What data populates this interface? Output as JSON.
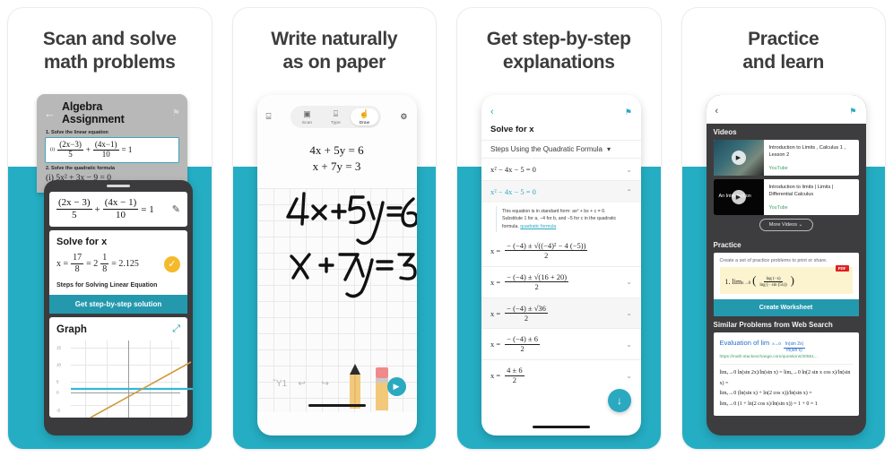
{
  "accent": {
    "teal": "#25adc3",
    "teal_dark": "#2499ae",
    "yellow": "#f5ba2b",
    "link_blue": "#2a6fc9",
    "green": "#3f9c6d",
    "pdf_red": "#e02020"
  },
  "panels": [
    {
      "id": "panel-scan",
      "headline_line1": "Scan and solve",
      "headline_line2": "math problems",
      "worksheet": {
        "back_icon": "←",
        "title": "Algebra Assignment",
        "flag_icon": "⚑",
        "q1_label": "1. Solve the linear equation",
        "q1_marker": "(i)",
        "q1_num_a": "(2x−3)",
        "q1_den_a": "5",
        "q1_plus": "+",
        "q1_num_b": "(4x−1)",
        "q1_den_b": "10",
        "q1_equals": "= 1",
        "q2_label": "2. Solve the quadratic formula",
        "q2_expr": "(i) 5x² + 3x − 9 = 0"
      },
      "result_card": {
        "num_a": "(2x − 3)",
        "den_a": "5",
        "plus": "+",
        "num_b": "(4x − 1)",
        "den_b": "10",
        "equals": "= 1",
        "edit_icon": "✎"
      },
      "solve_card": {
        "heading": "Solve for x",
        "answer_lead": "x =",
        "answer_frac_num": "17",
        "answer_frac_den": "8",
        "answer_mid": "= 2",
        "answer_mixed_num": "1",
        "answer_mixed_den": "8",
        "answer_tail": "= 2.125",
        "check_icon": "✓",
        "steps_label": "Steps for Solving Linear Equation",
        "cta": "Get step-by-step solution"
      },
      "graph_card": {
        "title": "Graph",
        "expand_icon": "⤢"
      }
    },
    {
      "id": "panel-write",
      "headline_line1": "Write naturally",
      "headline_line2": "as on paper",
      "toolbar": {
        "left_icon": "⌸",
        "gear_icon": "⚙",
        "modes": [
          {
            "label": "Scan",
            "glyph": "▣",
            "active": false
          },
          {
            "label": "Type",
            "glyph": "⌸",
            "active": false
          },
          {
            "label": "Draw",
            "glyph": "☝",
            "active": true
          }
        ]
      },
      "typed_equations": [
        "4x + 5y = 6",
        "x + 7y = 3"
      ],
      "handwritten": [
        "4x+5y=6",
        "x +7y =3"
      ],
      "tools": {
        "trash_icon": "Ὕ1",
        "undo_icon": "↩",
        "redo_icon": "↪",
        "send_icon": "▶"
      }
    },
    {
      "id": "panel-steps",
      "headline_line1": "Get step-by-step",
      "headline_line2": "explanations",
      "bar": {
        "back_icon": "‹",
        "flag_icon": "⚑"
      },
      "title": "Solve for x",
      "method": "Steps Using the Quadratic Formula",
      "method_caret": "▾",
      "steps": [
        {
          "expr": "x² − 4x − 5 = 0",
          "chev": "⌄",
          "active": false,
          "alt": false
        },
        {
          "expr": "x² − 4x − 5 = 0",
          "chev": "⌃",
          "active": true,
          "alt": true
        }
      ],
      "explanation_html": "This equation is in standard form: ax² + bx + c = 0. Substitute 1 for a, −4 for b, and −5 for c in the quadratic formula.",
      "explanation_link": "quadratic formula",
      "derivations": [
        {
          "lead": "x =",
          "num": "− (−4) ± √((−4)² − 4 (−5))",
          "den": "2",
          "chev": ""
        },
        {
          "lead": "x =",
          "num": "− (−4) ± √(16 + 20)",
          "den": "2",
          "chev": "⌄"
        },
        {
          "lead": "x =",
          "num": "− (−4) ± √36",
          "den": "2",
          "chev": "⌄"
        },
        {
          "lead": "x =",
          "num": "− (−4) ± 6",
          "den": "2",
          "chev": "⌄"
        },
        {
          "lead": "x =",
          "num": "4 ± 6",
          "den": "2",
          "chev": "⌄"
        }
      ],
      "fab_icon": "↓"
    },
    {
      "id": "panel-practice",
      "headline_line1": "Practice",
      "headline_line2": "and learn",
      "bar": {
        "back_icon": "‹",
        "flag_icon": "⚑"
      },
      "videos_heading": "Videos",
      "videos": [
        {
          "title": "Introduction to Limits , Calculus 1 , Lesson 2",
          "source": "YouTube",
          "play_icon": "▶",
          "thumb_label": ""
        },
        {
          "title": "Introduction to limits | Limits | Differential Calculus",
          "source": "YouTube",
          "play_icon": "▶",
          "thumb_label": "An Introduction"
        }
      ],
      "more_videos": "More Videos",
      "more_videos_caret": "⌄",
      "practice_heading": "Practice",
      "practice_hint": "Create a set of practice problems to print or share.",
      "practice_problem_index": "1.",
      "practice_problem": "lim",
      "practice_sub": "x→0",
      "practice_frac_num": "log (−x)",
      "practice_frac_den": "log (− sin (5x))",
      "pdf_badge": "PDF",
      "create_worksheet": "Create Worksheet",
      "similar_heading": "Similar Problems from Web Search",
      "similar_title": "Evaluation of lim",
      "similar_title_sub": "x→0",
      "similar_frac_num": "ln(sin 2x)",
      "similar_frac_den": "ln(sin x)",
      "similar_url": "https://math.stackexchange.com/questions/20551...",
      "similar_work": [
        "limₓ→0 ln(sin 2x)/ln(sin x) = limₓ→0 ln(2 sin x cos x)/ln(sin x) =",
        "limₓ→0 (ln(sin x) + ln(2 cos x))/ln(sin x) =",
        "limₓ→0 (1 + ln(2 cos x)/ln(sin x)) = 1 + 0 = 1"
      ]
    }
  ],
  "graph_data": {
    "type": "line",
    "title": "Graph",
    "y_ticks": [
      "15",
      "10",
      "5",
      "0",
      "-5"
    ],
    "ylim": [
      -7,
      16
    ],
    "xlim": [
      -5,
      5
    ],
    "grid": true,
    "series": [
      {
        "name": "constant",
        "color": "#35b8d8",
        "type": "horizontal",
        "y": 1.6
      },
      {
        "name": "linear",
        "color": "#cf9a3a",
        "slope": 2.6,
        "intercept": 0.3
      }
    ]
  }
}
